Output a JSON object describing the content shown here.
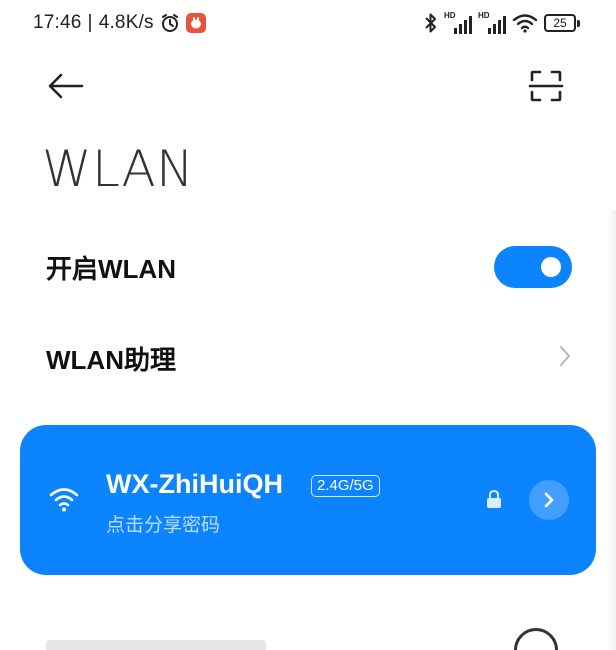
{
  "status_bar": {
    "time": "17:46",
    "separator": "|",
    "net_speed": "4.8K/s",
    "battery_level": "25",
    "icons": [
      "alarm-icon",
      "app-notification-icon",
      "bluetooth-icon",
      "hd-signal-icon",
      "hd-signal-icon",
      "wifi-icon",
      "battery-icon"
    ]
  },
  "header": {
    "title": "WLAN",
    "back_icon": "arrow-left-icon",
    "scan_icon": "scan-icon"
  },
  "settings": {
    "wlan_toggle": {
      "label": "开启WLAN",
      "enabled": true
    },
    "assistant": {
      "label": "WLAN助理"
    }
  },
  "connected_network": {
    "ssid": "WX-ZhiHuiQH",
    "band": "2.4G/5G",
    "subtitle": "点击分享密码",
    "secured": true
  },
  "colors": {
    "accent": "#0d84ff",
    "background": "#ffffff",
    "text": "#111111"
  }
}
